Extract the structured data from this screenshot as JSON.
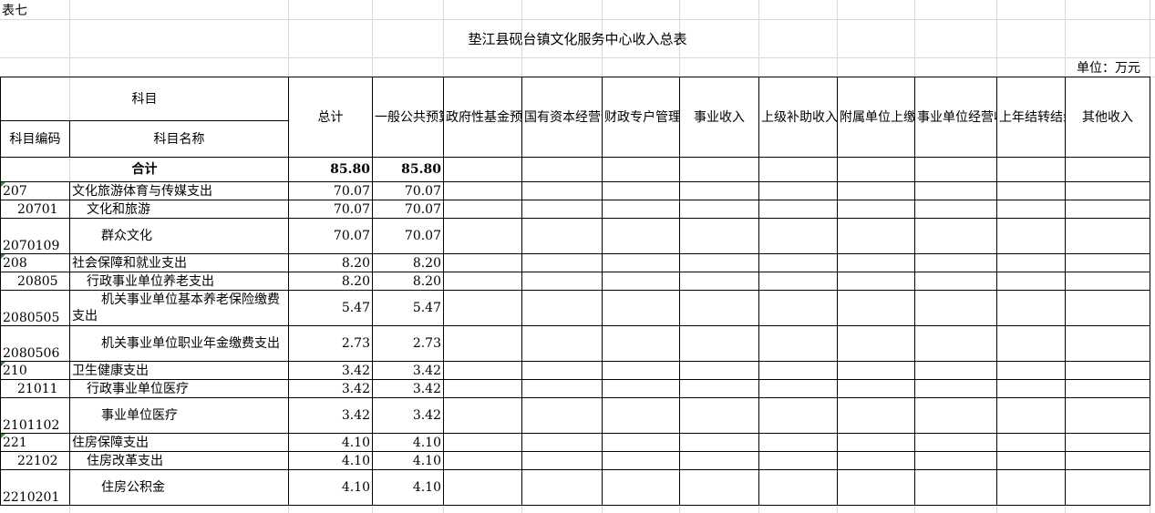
{
  "sheet_label": "表七",
  "title": "垫江县砚台镇文化服务中心收入总表",
  "unit": "单位：万元",
  "headers": {
    "subject": "科目",
    "code": "科目编码",
    "name": "科目名称",
    "total": "总计",
    "general_budget": "一般公共预算拨款收入",
    "gov_fund": "政府性基金预算拨款收入",
    "state_capital": "国有资本经营预算拨款收入",
    "fiscal_special": "财政专户管理资金收入",
    "business_income": "事业收入",
    "higher_subsidy": "上级补助收入",
    "affiliated": "附属单位上缴收入",
    "operating": "事业单位经营收入",
    "carryover": "上年结转结余资金",
    "other": "其他收入"
  },
  "total_row": {
    "label": "合计",
    "total": "85.80",
    "general": "85.80"
  },
  "rows": [
    {
      "code": "207",
      "name": "文化旅游体育与传媒支出",
      "level": 1,
      "total": "70.07",
      "general": "70.07"
    },
    {
      "code": "20701",
      "name": "文化和旅游",
      "level": 2,
      "total": "70.07",
      "general": "70.07"
    },
    {
      "code": "2070109",
      "name": "群众文化",
      "level": 3,
      "total": "70.07",
      "general": "70.07"
    },
    {
      "code": "208",
      "name": "社会保障和就业支出",
      "level": 1,
      "total": "8.20",
      "general": "8.20"
    },
    {
      "code": "20805",
      "name": "行政事业单位养老支出",
      "level": 2,
      "total": "8.20",
      "general": "8.20"
    },
    {
      "code": "2080505",
      "name": "机关事业单位基本养老保险缴费支出",
      "level": 3,
      "total": "5.47",
      "general": "5.47"
    },
    {
      "code": "2080506",
      "name": "机关事业单位职业年金缴费支出",
      "level": 3,
      "total": "2.73",
      "general": "2.73"
    },
    {
      "code": "210",
      "name": "卫生健康支出",
      "level": 1,
      "total": "3.42",
      "general": "3.42"
    },
    {
      "code": "21011",
      "name": "行政事业单位医疗",
      "level": 2,
      "total": "3.42",
      "general": "3.42"
    },
    {
      "code": "2101102",
      "name": "事业单位医疗",
      "level": 3,
      "total": "3.42",
      "general": "3.42"
    },
    {
      "code": "221",
      "name": "住房保障支出",
      "level": 1,
      "total": "4.10",
      "general": "4.10"
    },
    {
      "code": "22102",
      "name": "住房改革支出",
      "level": 2,
      "total": "4.10",
      "general": "4.10"
    },
    {
      "code": "2210201",
      "name": "住房公积金",
      "level": 3,
      "total": "4.10",
      "general": "4.10"
    }
  ],
  "colors": {
    "border": "#000000",
    "gridline": "#d9d9d9",
    "error_marker": "#2e8b3a"
  }
}
